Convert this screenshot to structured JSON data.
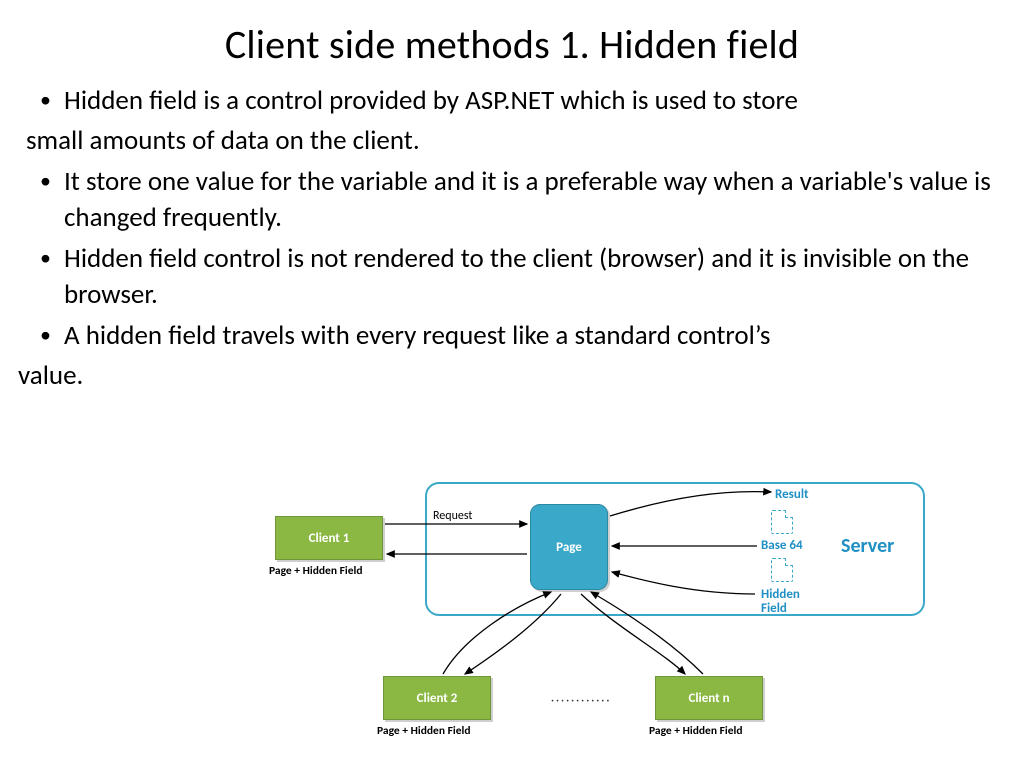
{
  "title": "Client side methods  1. Hidden field",
  "bullets": {
    "b1_line1": "Hidden field is a control provided by ASP.NET which is used to store",
    "b1_cont": "small amounts of data on the client.",
    "b2": " It store one value for the variable and it is a preferable way when a variable's value is changed frequently.",
    "b3": "Hidden field control is not rendered to the client (browser) and it is invisible on the browser.",
    "b4_line1": " A hidden field travels with every request like a standard control’s",
    "b4_cont": "value."
  },
  "diagram": {
    "server": "Server",
    "page": "Page",
    "client1": "Client 1",
    "client2": "Client 2",
    "clientn": "Client n",
    "request": "Request",
    "caption": "Page + Hidden Field",
    "result": "Result",
    "base64": "Base 64",
    "hidden_field": "Hidden\nField",
    "dots": "············"
  }
}
